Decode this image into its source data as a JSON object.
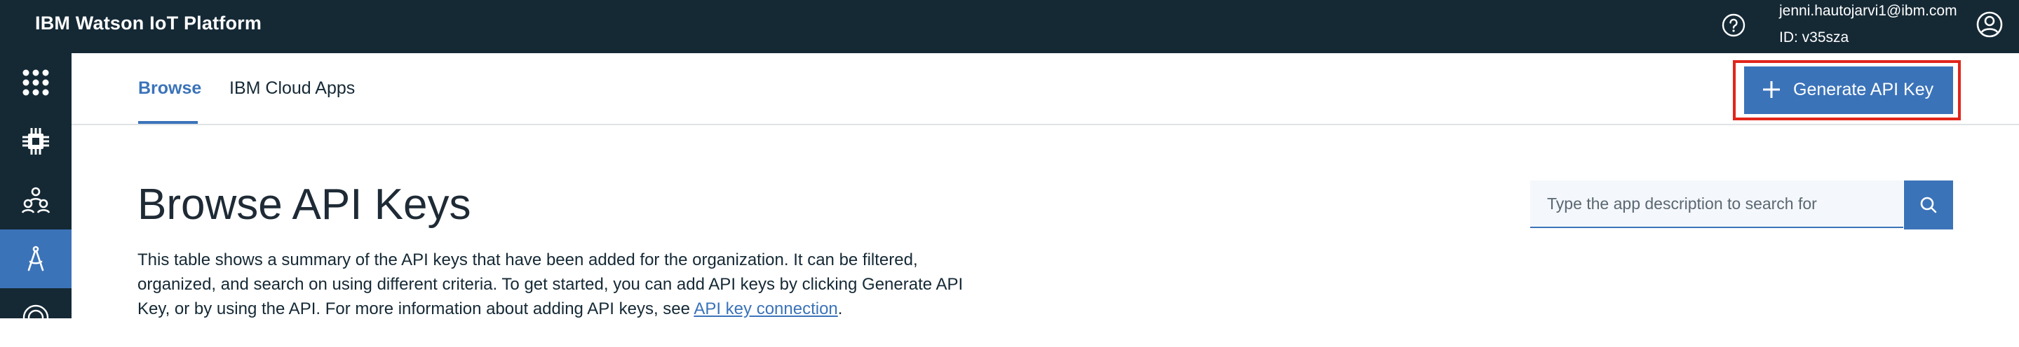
{
  "app": {
    "title": "IBM Watson IoT Platform"
  },
  "header": {
    "help_icon": "help-circle-icon",
    "user_email": "jenni.hautojarvi1@ibm.com",
    "org_id": "ID: v35sza",
    "profile_icon": "user-avatar-icon"
  },
  "sidebar": {
    "items": [
      {
        "icon": "apps-grid-icon",
        "active": false
      },
      {
        "icon": "devices-chip-icon",
        "active": false
      },
      {
        "icon": "members-icon",
        "active": false
      },
      {
        "icon": "apps-compass-icon",
        "active": true
      },
      {
        "icon": "security-icon",
        "active": false
      }
    ]
  },
  "tabs": [
    {
      "label": "Browse",
      "active": true
    },
    {
      "label": "IBM Cloud Apps",
      "active": false
    }
  ],
  "actions": {
    "generate_label": "Generate API Key"
  },
  "main": {
    "title": "Browse API Keys",
    "description": "This table shows a summary of the API keys that have been added for the organization. It can be filtered, organized, and search on using different criteria. To get started, you can add API keys by clicking Generate API Key, or by using the API. For more information about adding API keys, see ",
    "link_text": "API key connection",
    "description_end": "."
  },
  "search": {
    "placeholder": "Type the app description to search for",
    "value": ""
  },
  "colors": {
    "header_bg": "#152935",
    "accent": "#3b73b9",
    "highlight": "#e1251b"
  }
}
